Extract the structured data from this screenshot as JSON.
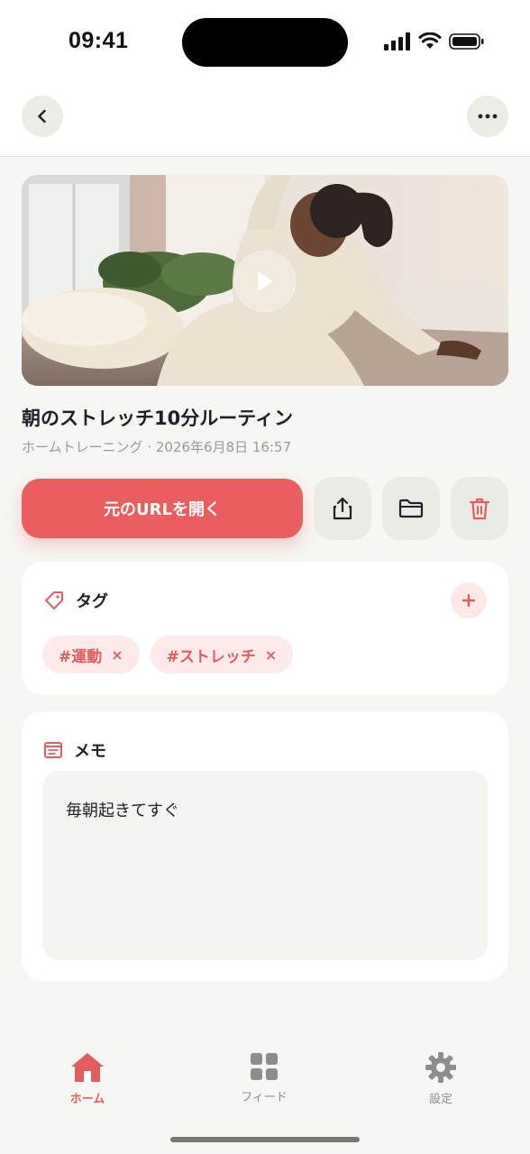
{
  "status_bar": {
    "time": "09:41"
  },
  "colors": {
    "accent": "#ea5e5e",
    "background": "#f6f6f2",
    "tag_bg": "#fdeaea"
  },
  "nav": {
    "back_icon": "chevron-left-icon",
    "more_icon": "ellipsis-icon"
  },
  "item": {
    "title": "朝のストレッチ10分ルーティン",
    "meta": "ホームトレーニング · 2026年6月8日 16:57"
  },
  "actions": {
    "open_url_label": "元のURLを開く",
    "icons": [
      "share-icon",
      "folder-icon",
      "trash-icon"
    ]
  },
  "tags": {
    "title": "タグ",
    "items": [
      {
        "label": "#運動",
        "remove": "×"
      },
      {
        "label": "#ストレッチ",
        "remove": "×"
      }
    ],
    "add": "+"
  },
  "memo": {
    "title": "メモ",
    "text": "毎朝起きてすぐ"
  },
  "tab_bar": {
    "items": [
      {
        "label": "ホーム",
        "icon": "home-icon",
        "active": true
      },
      {
        "label": "フィード",
        "icon": "grid-icon",
        "active": false
      },
      {
        "label": "設定",
        "icon": "gear-icon",
        "active": false
      }
    ]
  }
}
